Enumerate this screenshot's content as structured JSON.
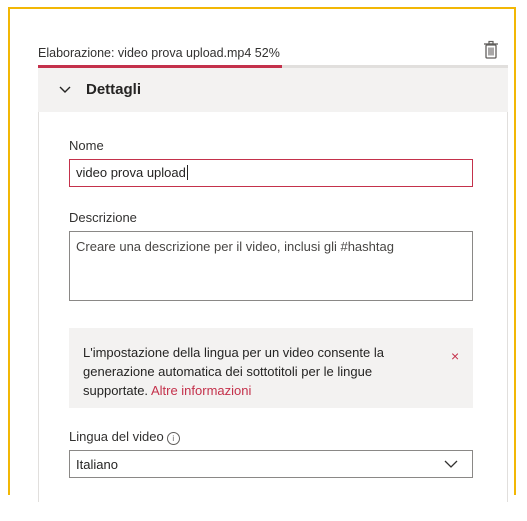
{
  "upload": {
    "status_text": "Elaborazione: video prova upload.mp4 52%",
    "progress": 0.52,
    "delete_icon": "trash-icon"
  },
  "details": {
    "title": "Dettagli",
    "chevron_icon": "chevron-down-icon"
  },
  "form": {
    "name_label": "Nome",
    "name_value": "video prova upload",
    "description_label": "Descrizione",
    "description_placeholder": "Creare una descrizione per il video, inclusi gli #hashtag",
    "info_text": "L'impostazione della lingua per un video consente la generazione automatica dei sottotitoli per le lingue supportate.",
    "info_link": "Altre informazioni",
    "info_close": "×",
    "language_label": "Lingua del video",
    "language_info_icon": "i",
    "language_value": "Italiano"
  },
  "colors": {
    "accent": "#c4314b",
    "frame": "#f2b705",
    "header_bg": "#f3f2f1"
  }
}
